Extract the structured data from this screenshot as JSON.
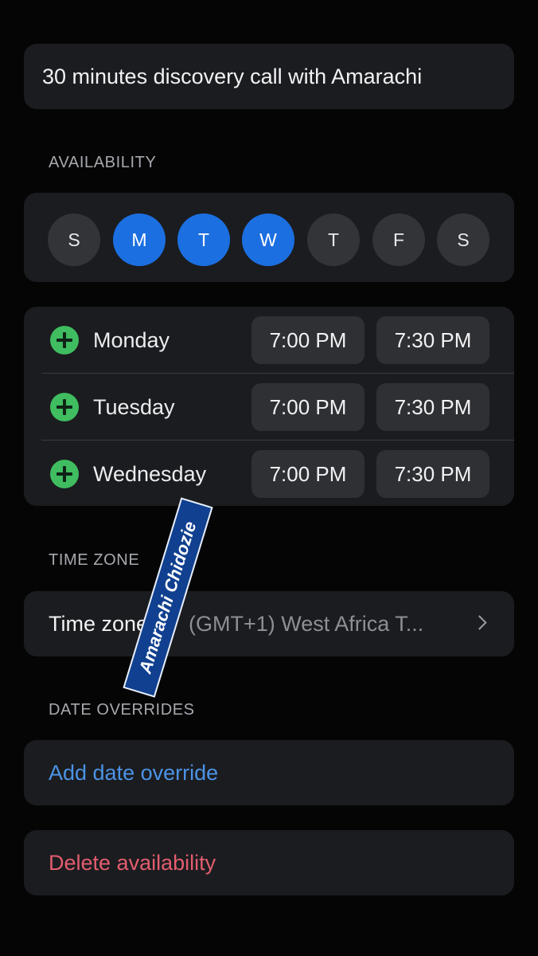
{
  "event_title": "30 minutes discovery call with Amarachi",
  "sections": {
    "availability": "AVAILABILITY",
    "time_zone": "TIME ZONE",
    "date_overrides": "DATE OVERRIDES"
  },
  "weekdays": [
    {
      "letter": "S",
      "selected": false
    },
    {
      "letter": "M",
      "selected": true
    },
    {
      "letter": "T",
      "selected": true
    },
    {
      "letter": "W",
      "selected": true
    },
    {
      "letter": "T",
      "selected": false
    },
    {
      "letter": "F",
      "selected": false
    },
    {
      "letter": "S",
      "selected": false
    }
  ],
  "hours": [
    {
      "day": "Monday",
      "start": "7:00 PM",
      "end": "7:30 PM"
    },
    {
      "day": "Tuesday",
      "start": "7:00 PM",
      "end": "7:30 PM"
    },
    {
      "day": "Wednesday",
      "start": "7:00 PM",
      "end": "7:30 PM"
    }
  ],
  "timezone": {
    "label": "Time zone",
    "value": "(GMT+1) West Africa T..."
  },
  "actions": {
    "add_override": "Add date override",
    "delete": "Delete availability"
  },
  "watermark": "Amarachi Chidozie",
  "colors": {
    "background": "#050506",
    "card": "#1b1c1f",
    "selected_day": "#1b6fe0",
    "add_icon": "#3fbd60",
    "link_blue": "#4c93e6",
    "danger_red": "#e35d6f"
  },
  "icons": [
    "plus-circle-icon",
    "chevron-right-icon"
  ]
}
